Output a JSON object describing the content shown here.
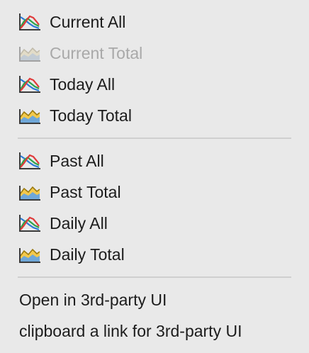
{
  "menu": {
    "groups": [
      {
        "items": [
          {
            "label": "Current All",
            "icon": "multi-line-chart-icon",
            "enabled": true
          },
          {
            "label": "Current Total",
            "icon": "area-chart-icon",
            "enabled": false
          },
          {
            "label": "Today All",
            "icon": "multi-line-chart-icon",
            "enabled": true
          },
          {
            "label": "Today Total",
            "icon": "area-chart-icon",
            "enabled": true
          }
        ]
      },
      {
        "items": [
          {
            "label": "Past All",
            "icon": "multi-line-chart-icon",
            "enabled": true
          },
          {
            "label": "Past Total",
            "icon": "area-chart-icon",
            "enabled": true
          },
          {
            "label": "Daily All",
            "icon": "multi-line-chart-icon",
            "enabled": true
          },
          {
            "label": "Daily Total",
            "icon": "area-chart-icon",
            "enabled": true
          }
        ]
      },
      {
        "items": [
          {
            "label": "Open in 3rd-party UI",
            "enabled": true
          },
          {
            "label": "clipboard a link for 3rd-party UI",
            "enabled": true
          }
        ]
      }
    ],
    "colors": {
      "background": "#e9e9e9",
      "text": "#1c1c1c",
      "disabled_text": "#a9a9a9",
      "separator": "#cfcfcf"
    }
  }
}
